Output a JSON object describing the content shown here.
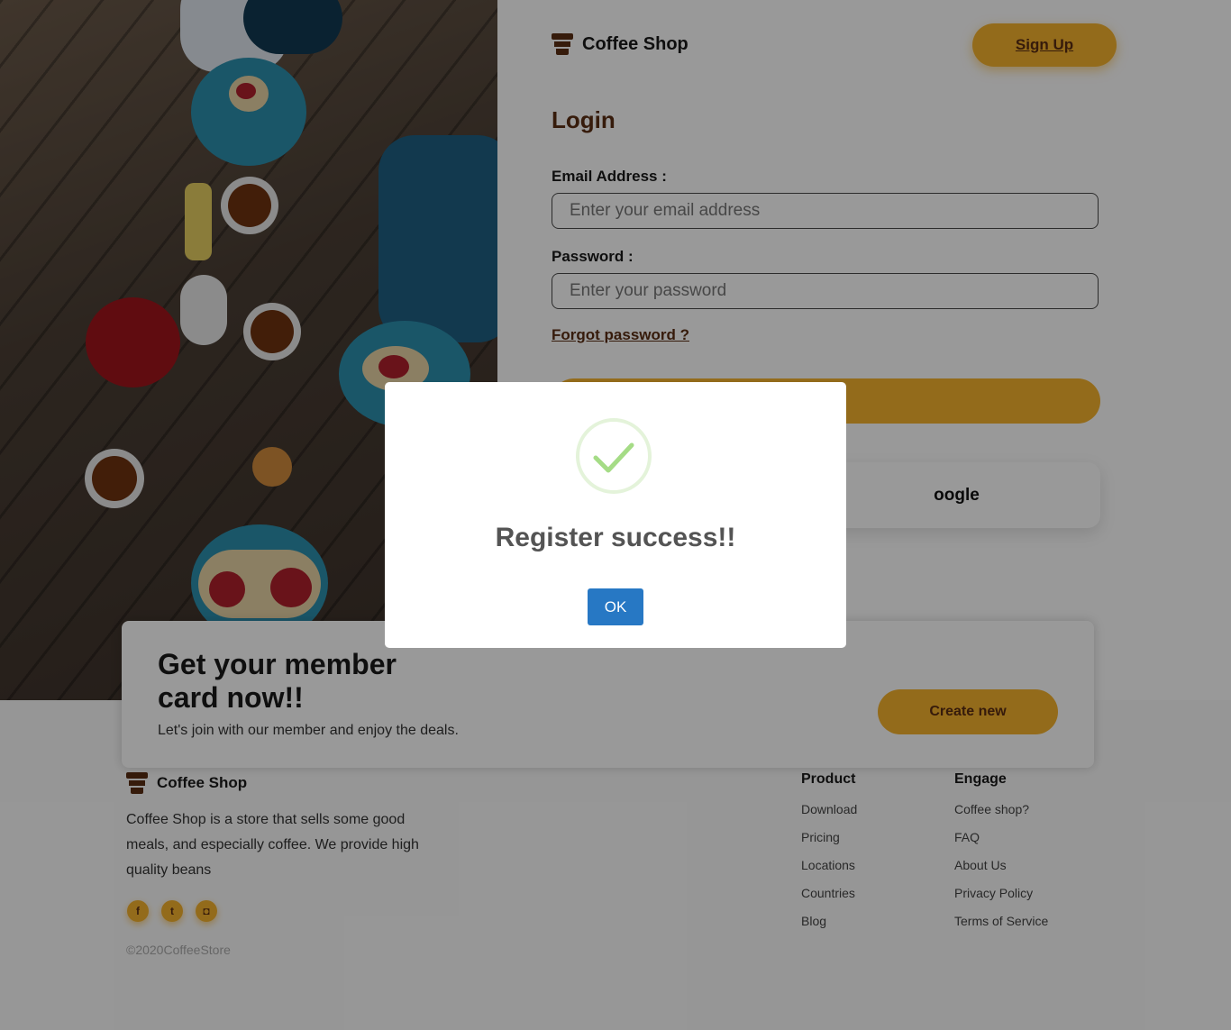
{
  "header": {
    "brand_name": "Coffee Shop",
    "signup_label": "Sign Up"
  },
  "login": {
    "title": "Login",
    "email_label": "Email Address :",
    "email_placeholder": "Enter your email address",
    "password_label": "Password :",
    "password_placeholder": "Enter your password",
    "forgot_label": "Forgot password ?",
    "google_label_visible": "oogle"
  },
  "member_card": {
    "title": "Get your member card now!!",
    "subtitle": "Let's join with our member and enjoy the deals.",
    "create_label": "Create new"
  },
  "footer": {
    "brand_name": "Coffee Shop",
    "description": "Coffee Shop is a store that sells some good meals, and especially coffee. We provide high quality beans",
    "social": [
      {
        "icon": "facebook-icon",
        "glyph": "f"
      },
      {
        "icon": "twitter-icon",
        "glyph": "t"
      },
      {
        "icon": "instagram-icon",
        "glyph": "◘"
      }
    ],
    "copyright": "©2020CoffeeStore",
    "columns": [
      {
        "title": "Product",
        "links": [
          "Download",
          "Pricing",
          "Locations",
          "Countries",
          "Blog"
        ]
      },
      {
        "title": "Engage",
        "links": [
          "Coffee shop?",
          "FAQ",
          "About Us",
          "Privacy Policy",
          "Terms of Service"
        ]
      }
    ]
  },
  "modal": {
    "icon": "checkmark-icon",
    "title": "Register success!!",
    "ok_label": "OK"
  },
  "colors": {
    "accent": "#f6b22e",
    "brand_brown": "#5a2d13",
    "ok_blue": "#2778c4",
    "success_green": "#a5dc86"
  }
}
